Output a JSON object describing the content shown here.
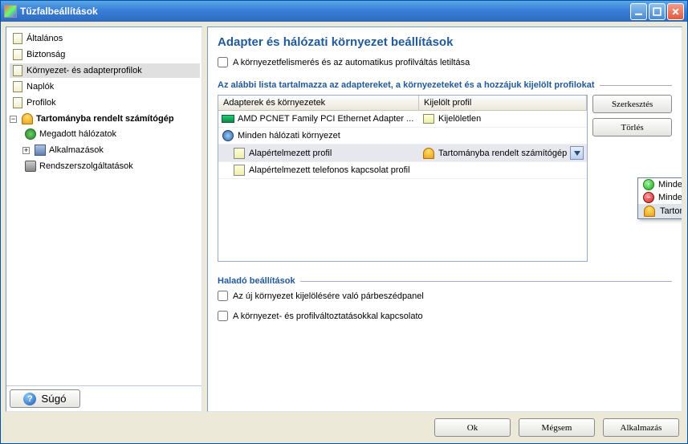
{
  "window": {
    "title": "Tűzfalbeállítások"
  },
  "tree": {
    "items": [
      {
        "label": "Általános"
      },
      {
        "label": "Biztonság"
      },
      {
        "label": "Környezet- és adapterprofilok"
      },
      {
        "label": "Naplók"
      },
      {
        "label": "Profilok"
      },
      {
        "label": "Tartományba rendelt számítógép"
      },
      {
        "label": "Megadott hálózatok"
      },
      {
        "label": "Alkalmazások"
      },
      {
        "label": "Rendszerszolgáltatások"
      }
    ]
  },
  "content": {
    "heading": "Adapter és hálózati környezet beállítások",
    "chk_disable": "A környezetfelismerés és az automatikus profilváltás letiltása",
    "section_list": "Az alábbi lista tartalmazza az adaptereket, a környezeteket és a hozzájuk kijelölt profilokat",
    "col_adapters": "Adapterek és környezetek",
    "col_profile": "Kijelölt profil",
    "rows": [
      {
        "name": "AMD PCNET Family PCI Ethernet Adapter ...",
        "profile": "Kijelöletlen"
      },
      {
        "name": "Minden hálózati környezet",
        "profile": ""
      },
      {
        "name": "Alapértelmezett profil",
        "profile": "Tartományba rendelt számítógép"
      },
      {
        "name": "Alapértelmezett telefonos kapcsolat profil",
        "profile": ""
      }
    ],
    "btn_edit": "Szerkesztés",
    "btn_delete": "Törlés",
    "section_adv": "Haladó beállítások",
    "chk_adv1": "Az új környezet kijelölésére való párbeszédpanel",
    "chk_adv2": "A környezet- és profilváltoztatásokkal kapcsolato"
  },
  "dropdown": {
    "items": [
      {
        "label": "Mindet engedélyezze"
      },
      {
        "label": "Minden letiltása"
      },
      {
        "label": "Tartományba rendelt számítógép"
      }
    ]
  },
  "footer": {
    "help": "Súgó",
    "ok": "Ok",
    "cancel": "Mégsem",
    "apply": "Alkalmazás"
  }
}
